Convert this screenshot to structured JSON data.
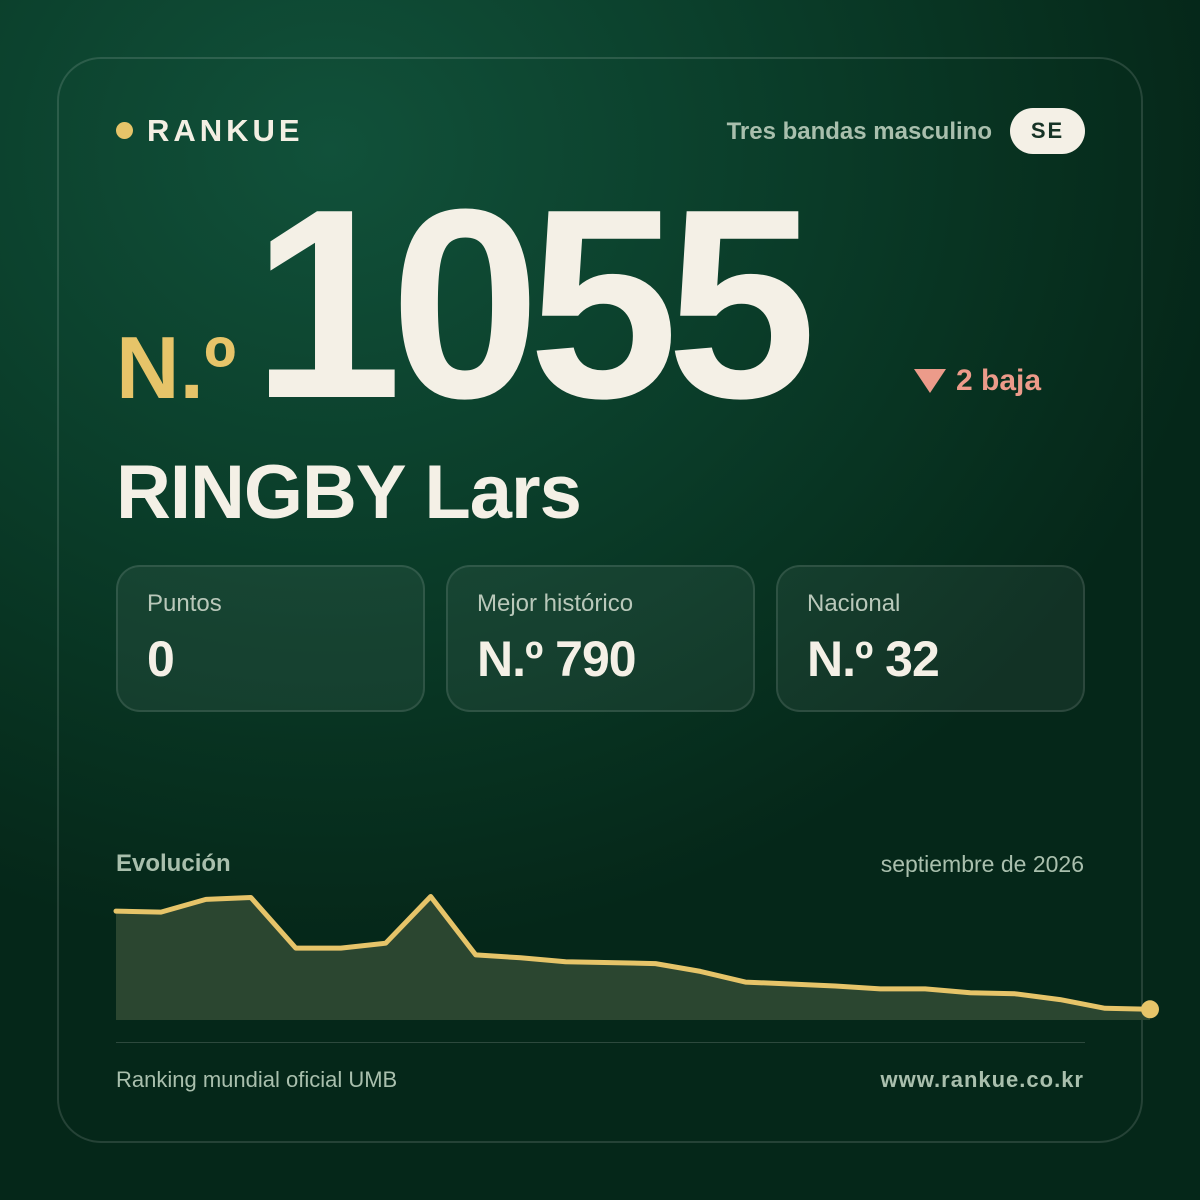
{
  "header": {
    "brand": "RANKUE",
    "category": "Tres bandas masculino",
    "country_code": "SE"
  },
  "rank": {
    "prefix": "N.º",
    "number": "1055",
    "trend_text": "2 baja",
    "trend_direction": "down"
  },
  "player": {
    "name": "RINGBY Lars"
  },
  "stats": [
    {
      "label": "Puntos",
      "value": "0"
    },
    {
      "label": "Mejor histórico",
      "value": "N.º 790"
    },
    {
      "label": "Nacional",
      "value": "N.º 32"
    }
  ],
  "chart": {
    "title": "Evolución",
    "date": "septiembre de 2026"
  },
  "chart_data": {
    "type": "area",
    "inverted_y": true,
    "values": [
      912,
      913,
      900,
      898,
      950,
      950,
      945,
      897,
      957,
      960,
      964,
      965,
      966,
      974,
      985,
      987,
      989,
      992,
      992,
      996,
      997,
      1003,
      1012,
      1013
    ],
    "ylim": [
      880,
      1060
    ],
    "grid": false
  },
  "footer": {
    "source": "Ranking mundial oficial UMB",
    "website": "www.rankue.co.kr"
  },
  "colors": {
    "accent": "#e6c469",
    "background": "#0b3f2b",
    "text": "#f4f0e6",
    "muted": "#a9bfad",
    "trend_down": "#ec9b8a",
    "area_fill": "#2b4630"
  }
}
